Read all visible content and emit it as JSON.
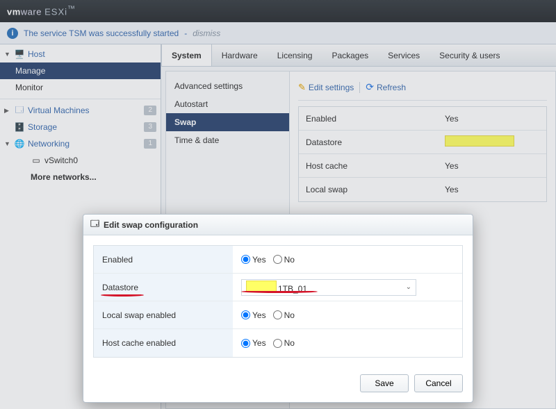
{
  "brand": {
    "vm": "vm",
    "ware": "ware",
    "prod": "ESXi",
    "tm": "™"
  },
  "notice": {
    "text": "The service TSM was successfully started",
    "dismiss": "dismiss"
  },
  "nav": {
    "host": "Host",
    "manage": "Manage",
    "monitor": "Monitor",
    "vms": "Virtual Machines",
    "storage": "Storage",
    "net": "Networking",
    "vswitch": "vSwitch0",
    "more_net": "More networks...",
    "badge_vms": "2",
    "badge_storage": "3",
    "badge_net": "1"
  },
  "tabs": [
    "System",
    "Hardware",
    "Licensing",
    "Packages",
    "Services",
    "Security & users"
  ],
  "subnav": [
    "Advanced settings",
    "Autostart",
    "Swap",
    "Time & date"
  ],
  "toolbar": {
    "edit": "Edit settings",
    "refresh": "Refresh"
  },
  "kv": {
    "enabled_k": "Enabled",
    "enabled_v": "Yes",
    "ds_k": "Datastore",
    "hc_k": "Host cache",
    "hc_v": "Yes",
    "ls_k": "Local swap",
    "ls_v": "Yes"
  },
  "dialog": {
    "title": "Edit swap configuration",
    "enabled": "Enabled",
    "datastore": "Datastore",
    "ds_value": "1TB_01",
    "local_swap": "Local swap enabled",
    "host_cache": "Host cache enabled",
    "yes": "Yes",
    "no": "No",
    "save": "Save",
    "cancel": "Cancel"
  }
}
